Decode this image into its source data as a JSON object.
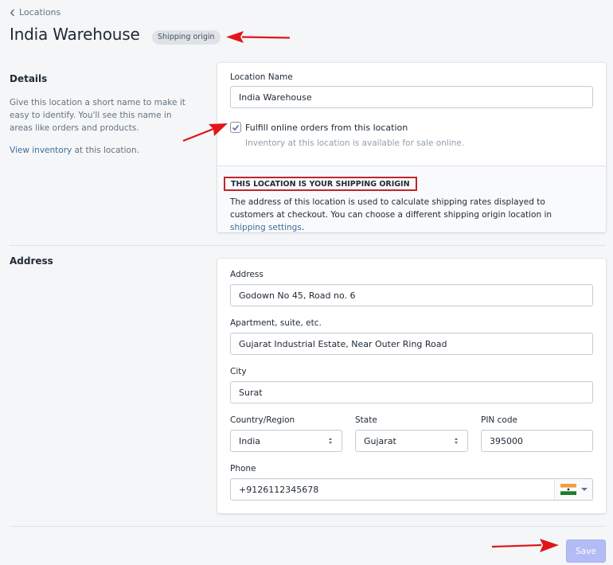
{
  "breadcrumb": {
    "label": "Locations"
  },
  "header": {
    "title": "India Warehouse",
    "badge": "Shipping origin"
  },
  "details": {
    "title": "Details",
    "description": "Give this location a short name to make it easy to identify. You'll see this name in areas like orders and products.",
    "view_inventory_link": "View inventory",
    "view_inventory_suffix": " at this location.",
    "location_name_label": "Location Name",
    "location_name_value": "India Warehouse",
    "fulfill_checkbox_label": "Fulfill online orders from this location",
    "fulfill_checked": true,
    "fulfill_help": "Inventory at this location is available for sale online.",
    "origin_heading": "THIS LOCATION IS YOUR SHIPPING ORIGIN",
    "origin_text": "The address of this location is used to calculate shipping rates displayed to customers at checkout. You can choose a different shipping origin location in ",
    "origin_link": "shipping settings",
    "origin_text_end": "."
  },
  "address": {
    "title": "Address",
    "address_label": "Address",
    "address_value": "Godown No 45, Road no. 6",
    "apartment_label": "Apartment, suite, etc.",
    "apartment_value": "Gujarat Industrial Estate, Near Outer Ring Road",
    "city_label": "City",
    "city_value": "Surat",
    "country_label": "Country/Region",
    "country_value": "India",
    "state_label": "State",
    "state_value": "Gujarat",
    "pin_label": "PIN code",
    "pin_value": "395000",
    "phone_label": "Phone",
    "phone_value": "+9126112345678",
    "phone_country_flag": "india-flag-icon"
  },
  "footer": {
    "save_label": "Save"
  },
  "colors": {
    "background": "#f4f6f8",
    "link": "#2c6ecb",
    "save_disabled": "#b3bcf5",
    "annotation_red": "#e0161b",
    "highlight_box": "#c0262c"
  }
}
